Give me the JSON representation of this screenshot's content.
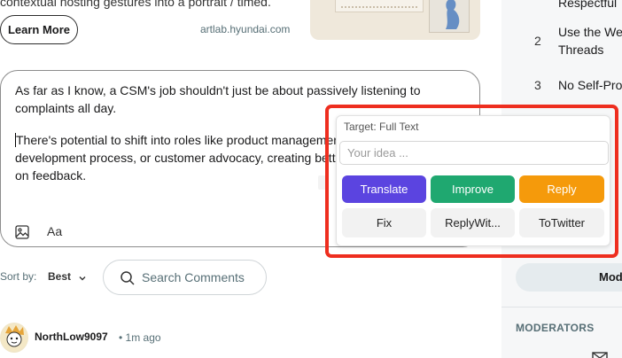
{
  "post": {
    "snippet": "contextual hosting gestures into a portrait / timed.",
    "learn_more": "Learn More",
    "domain": "artlab.hyundai.com"
  },
  "editor": {
    "paragraph1": "As far as I know, a CSM's job shouldn't just be about passively listening to complaints all day.",
    "paragraph2": "There's potential to shift into roles like product management, influence the development process, or customer advocacy, creating better experiences based on feedback."
  },
  "sort": {
    "label": "Sort by:",
    "value": "Best"
  },
  "search": {
    "placeholder": "Search Comments"
  },
  "comment": {
    "author": "NorthLow9097",
    "time": "1m ago",
    "separator": "•"
  },
  "sidebar": {
    "rules": [
      {
        "number": "",
        "text": "Respectful"
      },
      {
        "number": "2",
        "text": "Use the We Threads"
      },
      {
        "number": "3",
        "text": "No Self-Pro"
      }
    ],
    "mod_button": "Mod",
    "moderators_heading": "MODERATORS"
  },
  "popup": {
    "target_label": "Target: Full Text",
    "input_placeholder": "Your idea ...",
    "buttons": {
      "translate": "Translate",
      "improve": "Improve",
      "reply": "Reply",
      "fix": "Fix",
      "reply_with": "ReplyWit...",
      "to_twitter": "ToTwitter"
    }
  },
  "colors": {
    "translate": "#5b44e0",
    "improve": "#1fa870",
    "reply": "#f59a0b",
    "highlight_frame": "#ee2e1f"
  }
}
